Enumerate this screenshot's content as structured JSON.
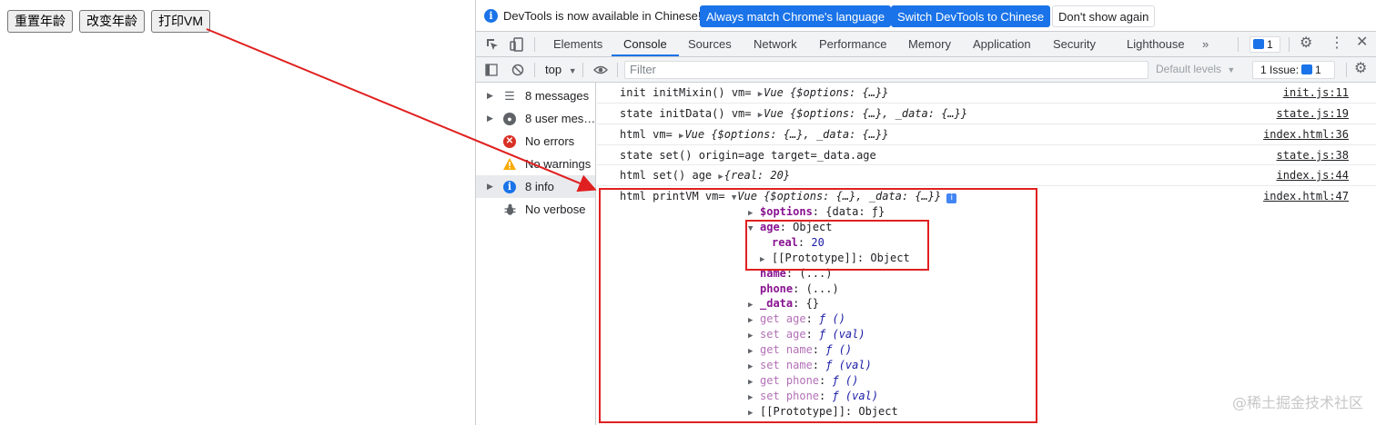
{
  "page": {
    "buttons": [
      "重置年龄",
      "改变年龄",
      "打印VM"
    ]
  },
  "infobar": {
    "message": "DevTools is now available in Chinese!",
    "match_language": "Always match Chrome's language",
    "switch_chinese": "Switch DevTools to Chinese",
    "dont_show": "Don't show again"
  },
  "tabs": [
    "Elements",
    "Console",
    "Sources",
    "Network",
    "Performance",
    "Memory",
    "Application",
    "Security",
    "Lighthouse"
  ],
  "tabs_overflow": "»",
  "issues_badge_count": "1",
  "toolbar": {
    "context": "top",
    "filter_placeholder": "Filter",
    "levels": "Default levels",
    "issue_label": "1 Issue:",
    "issue_count": "1"
  },
  "sidebar": [
    {
      "label": "8 messages",
      "icon": "list-icon",
      "arrow": true
    },
    {
      "label": "8 user mes…",
      "icon": "user-icon",
      "arrow": true
    },
    {
      "label": "No errors",
      "icon": "error-icon",
      "arrow": false
    },
    {
      "label": "No warnings",
      "icon": "warning-icon",
      "arrow": false
    },
    {
      "label": "8 info",
      "icon": "info-icon",
      "arrow": true,
      "selected": true
    },
    {
      "label": "No verbose",
      "icon": "bug-icon",
      "arrow": false
    }
  ],
  "messages": [
    {
      "prefix": "init initMixin() vm= ",
      "object": "Vue {$options: {…}}",
      "source": "init.js:11"
    },
    {
      "prefix": "state initData() vm= ",
      "object": "Vue {$options: {…}, _data: {…}}",
      "source": "state.js:19"
    },
    {
      "prefix": "html vm= ",
      "object": "Vue {$options: {…}, _data: {…}}",
      "source": "index.html:36"
    },
    {
      "prefix": "state set() origin=age target=_data.age",
      "object": "",
      "source": "state.js:38"
    },
    {
      "prefix": "html set() age ",
      "object": "{real: 20}",
      "source": "index.js:44"
    }
  ],
  "expanded": {
    "prefix": "html printVM vm= ",
    "object": "Vue {$options: {…}, _data: {…}}",
    "source": "index.html:47",
    "info_glyph": "i",
    "rows": [
      {
        "indent": 0,
        "arrow": "right",
        "key": "$options",
        "sep": ": ",
        "value": "{data: ƒ}",
        "keyClass": "purple",
        "valClass": ""
      },
      {
        "indent": 0,
        "arrow": "down",
        "key": "age",
        "sep": ": ",
        "value": "Object",
        "keyClass": "purple",
        "valClass": ""
      },
      {
        "indent": 1,
        "arrow": "",
        "key": "real",
        "sep": ": ",
        "value": "20",
        "keyClass": "purple",
        "valClass": "kv-num"
      },
      {
        "indent": 1,
        "arrow": "right",
        "key": "[[Prototype]]",
        "sep": ": ",
        "value": "Object",
        "keyClass": "",
        "valClass": ""
      },
      {
        "indent": 0,
        "arrow": "",
        "key": "name",
        "sep": ": ",
        "value": "(...)",
        "keyClass": "purple",
        "valClass": ""
      },
      {
        "indent": 0,
        "arrow": "",
        "key": "phone",
        "sep": ": ",
        "value": "(...)",
        "keyClass": "purple",
        "valClass": ""
      },
      {
        "indent": 0,
        "arrow": "right",
        "key": "_data",
        "sep": ": ",
        "value": "{}",
        "keyClass": "purple",
        "valClass": ""
      },
      {
        "indent": 0,
        "arrow": "right",
        "key": "get age",
        "sep": ": ",
        "value": "ƒ ()",
        "keyClass": "pale",
        "valClass": "fn"
      },
      {
        "indent": 0,
        "arrow": "right",
        "key": "set age",
        "sep": ": ",
        "value": "ƒ (val)",
        "keyClass": "pale",
        "valClass": "fn"
      },
      {
        "indent": 0,
        "arrow": "right",
        "key": "get name",
        "sep": ": ",
        "value": "ƒ ()",
        "keyClass": "pale",
        "valClass": "fn"
      },
      {
        "indent": 0,
        "arrow": "right",
        "key": "set name",
        "sep": ": ",
        "value": "ƒ (val)",
        "keyClass": "pale",
        "valClass": "fn"
      },
      {
        "indent": 0,
        "arrow": "right",
        "key": "get phone",
        "sep": ": ",
        "value": "ƒ ()",
        "keyClass": "pale",
        "valClass": "fn"
      },
      {
        "indent": 0,
        "arrow": "right",
        "key": "set phone",
        "sep": ": ",
        "value": "ƒ (val)",
        "keyClass": "pale",
        "valClass": "fn"
      },
      {
        "indent": 0,
        "arrow": "right",
        "key": "[[Prototype]]",
        "sep": ": ",
        "value": "Object",
        "keyClass": "",
        "valClass": ""
      }
    ]
  },
  "watermark": "@稀土掘金技术社区",
  "colors": {
    "accent": "#1a73e8",
    "annotation": "#e02020"
  }
}
